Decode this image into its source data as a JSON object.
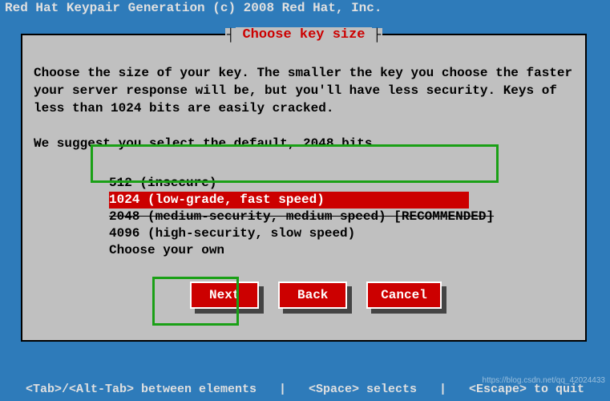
{
  "title": "Red Hat Keypair Generation (c) 2008 Red Hat, Inc.",
  "dialog": {
    "title": "Choose key size",
    "body_line1": "Choose the size of your key. The smaller the key you choose the faster",
    "body_line2": "your server response will be, but you'll have less security. Keys of",
    "body_line3": "less than 1024 bits are easily cracked.",
    "body_line4": "We suggest you select the default, 2048 bits.",
    "options": [
      {
        "label": "512 (insecure)",
        "strike": true,
        "selected": false
      },
      {
        "label": "1024 (low-grade, fast speed)",
        "strike": false,
        "selected": true
      },
      {
        "label": "2048 (medium-security, medium speed) [RECOMMENDED]",
        "strike": true,
        "selected": false
      },
      {
        "label": "4096 (high-security, slow speed)",
        "strike": false,
        "selected": false
      },
      {
        "label": "Choose your own",
        "strike": false,
        "selected": false
      }
    ],
    "buttons": {
      "next": "Next",
      "back": "Back",
      "cancel": "Cancel"
    }
  },
  "footer": {
    "tab": "<Tab>/<Alt-Tab> between elements",
    "space": "<Space> selects",
    "escape": "<Escape> to quit"
  },
  "watermark": "https://blog.csdn.net/qq_42024433"
}
